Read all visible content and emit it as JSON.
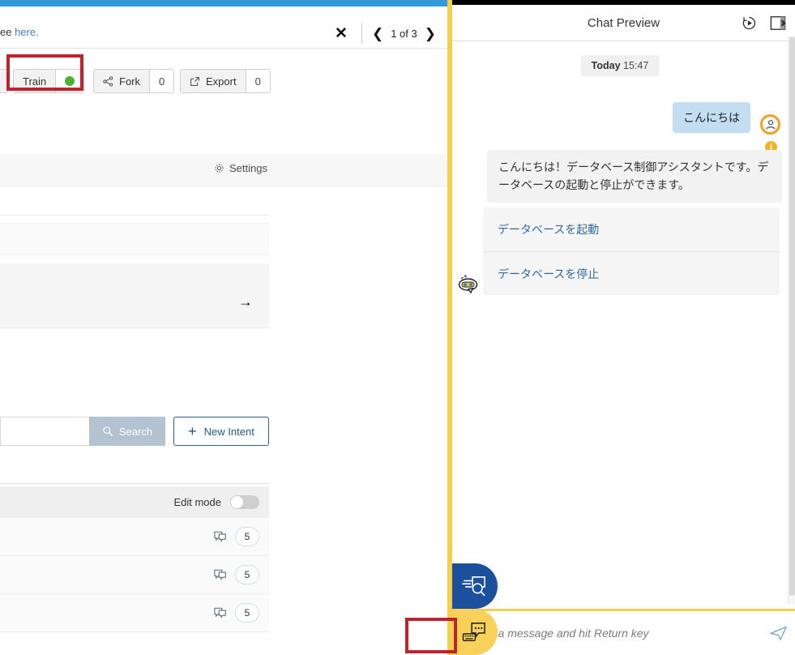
{
  "left_panel": {
    "notification": {
      "text_fragment": "ee ",
      "link_label": "here.",
      "close_icon": "close-icon"
    },
    "pager": {
      "prev_icon": "chevron-left-icon",
      "next_icon": "chevron-right-icon",
      "label": "1 of 3"
    },
    "toolbar": {
      "train_label": "Train",
      "train_status_icon": "green-status-dot-icon",
      "fork_label": "Fork",
      "fork_icon": "fork-icon",
      "fork_count": "0",
      "export_label": "Export",
      "export_icon": "export-icon",
      "export_count": "0"
    },
    "settings": {
      "label": "Settings",
      "icon": "gear-icon"
    },
    "search": {
      "value": "",
      "placeholder": "",
      "button_label": "Search",
      "button_icon": "search-icon"
    },
    "new_intent": {
      "label": "New Intent",
      "icon": "plus-icon"
    },
    "edit_mode": {
      "label": "Edit mode",
      "state": "off"
    },
    "intent_rows": [
      {
        "icon": "chat-bubbles-icon",
        "count": "5"
      },
      {
        "icon": "chat-bubbles-icon",
        "count": "5"
      },
      {
        "icon": "chat-bubbles-icon",
        "count": "5"
      }
    ],
    "arrow_icon": "arrow-right-icon"
  },
  "right_panel": {
    "header": {
      "title": "Chat Preview",
      "restart_icon": "restart-icon",
      "collapse_icon": "collapse-panel-icon"
    },
    "day_divider": {
      "day": "Today",
      "time": "15:47"
    },
    "messages": [
      {
        "role": "user",
        "text": "こんにちは",
        "avatar_icon": "user-avatar-icon"
      },
      {
        "role": "bot",
        "text": "こんにちは！データベース制御アシスタントです。データベースの起動と停止ができます。",
        "avatar_icon": "bot-avatar-icon",
        "info_badge": "i"
      }
    ],
    "quick_replies": [
      "データベースを起動",
      "データベースを停止"
    ],
    "composer": {
      "placeholder": "Write a message and hit Return key",
      "value": "",
      "send_icon": "send-icon"
    },
    "fab_blue": {
      "icon": "chat-search-icon"
    },
    "fab_yellow": {
      "icon": "chat-keyboard-icon"
    }
  },
  "highlights": {
    "train_highlight_color": "#c0232b",
    "composer_highlight_color": "#c0232b"
  },
  "colors": {
    "top_bar_blue": "#3498db",
    "split_yellow": "#f4cf4c",
    "user_bubble": "#c3ddf2",
    "bot_bubble": "#f2f2f2",
    "accent_orange": "#f0a024",
    "fab_blue": "#1c4f9c",
    "fab_yellow": "#f8d05a",
    "status_green": "#4caf2f"
  }
}
